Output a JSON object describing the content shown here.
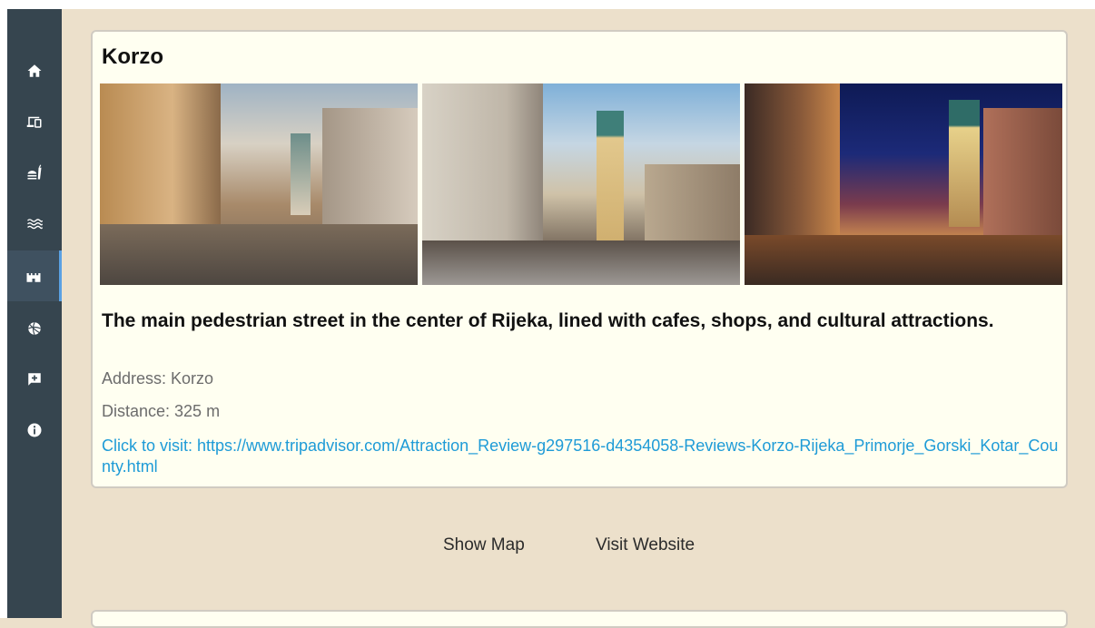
{
  "sidebar": {
    "items": [
      {
        "icon": "home-icon",
        "active": false
      },
      {
        "icon": "devices-icon",
        "active": false
      },
      {
        "icon": "food-icon",
        "active": false
      },
      {
        "icon": "waves-icon",
        "active": false
      },
      {
        "icon": "castle-icon",
        "active": true
      },
      {
        "icon": "sports-icon",
        "active": false
      },
      {
        "icon": "feedback-icon",
        "active": false
      },
      {
        "icon": "info-icon",
        "active": false
      }
    ]
  },
  "card": {
    "title": "Korzo",
    "description": "The main pedestrian street in the center of Rijeka, lined with cafes, shops, and cultural attractions.",
    "address": "Address: Korzo",
    "distance": "Distance: 325 m",
    "link": "Click to visit: https://www.tripadvisor.com/Attraction_Review-g297516-d4354058-Reviews-Korzo-Rijeka_Primorje_Gorski_Kotar_County.html"
  },
  "actions": {
    "show_map": "Show Map",
    "visit_website": "Visit Website"
  },
  "colors": {
    "sidebar_bg": "#36454f",
    "page_bg": "#ece0cb",
    "card_bg": "#fffff1",
    "link": "#1e9bd7",
    "active_indicator": "#5aa1e3"
  }
}
